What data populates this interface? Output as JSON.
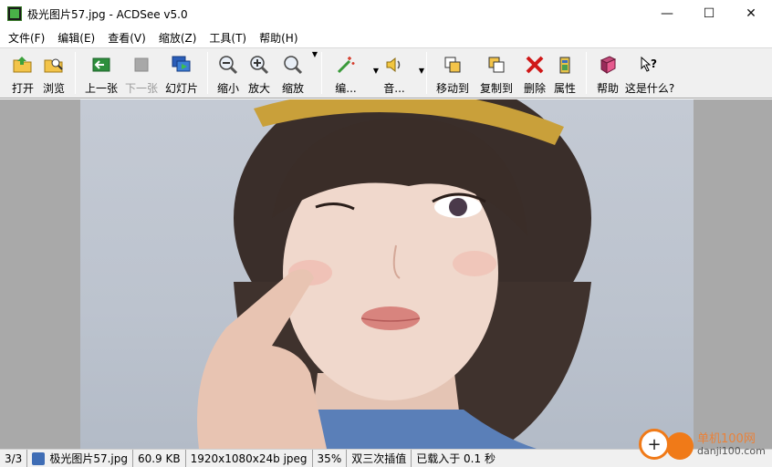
{
  "window": {
    "title": "极光图片57.jpg - ACDSee v5.0",
    "min_glyph": "—",
    "max_glyph": "☐",
    "close_glyph": "✕"
  },
  "menu": [
    "文件(F)",
    "编辑(E)",
    "查看(V)",
    "缩放(Z)",
    "工具(T)",
    "帮助(H)"
  ],
  "toolbar": {
    "open": "打开",
    "browse": "浏览",
    "prev": "上一张",
    "next": "下一张",
    "slideshow": "幻灯片",
    "zoom_out": "缩小",
    "zoom_in": "放大",
    "zoom": "缩放",
    "edit": "编...",
    "audio": "音...",
    "move_to": "移动到",
    "copy_to": "复制到",
    "delete": "删除",
    "properties": "属性",
    "help": "帮助",
    "whats_this": "这是什么?"
  },
  "statusbar": {
    "position": "3/3",
    "filename": "极光图片57.jpg",
    "filesize": "60.9 KB",
    "dimensions": "1920x1080x24b jpeg",
    "zoom": "35%",
    "interpolation": "双三次插值",
    "load_time": "已载入于 0.1 秒"
  },
  "watermark": {
    "site_name": "单机100网",
    "url": "danji100.com"
  },
  "colors": {
    "accent_orange": "#f07a18",
    "toolbar_bg": "#f0f0f0",
    "viewer_bg": "#a9a9a9"
  }
}
